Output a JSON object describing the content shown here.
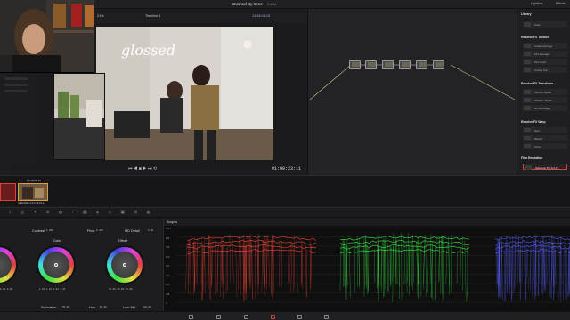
{
  "app": {
    "project_title": "Brushed By Irene",
    "project_state": "Edited"
  },
  "top_right": {
    "lightbox": "Lightbox",
    "fx": "Effects"
  },
  "viewer": {
    "timeline_name": "Timeline 1",
    "source_timecode": "13:48:08:15",
    "clip_label": "Clip",
    "zoom": "21%",
    "playhead_timecode": "01:00:23:11"
  },
  "clip_strip": {
    "clip_timecode": "13:48:08:15",
    "clip_name": "ILIBH Main 4-3-2 12-16-1"
  },
  "library": {
    "tab": "Library",
    "items_top": [
      {
        "label": "Grain"
      }
    ],
    "sections": [
      {
        "title": "Resolve FX Texture",
        "items": [
          "Analog Damage",
          "Film Damage",
          "Film Grain",
          "Texture Pop"
        ]
      },
      {
        "title": "Resolve FX Transform",
        "items": [
          "Camera Shake",
          "Surface Tracker",
          "Mirror Collage"
        ]
      },
      {
        "title": "Resolve FX Warp",
        "items": [
          "Dent",
          "Ripples",
          "Vortex"
        ]
      },
      {
        "title": "Film Emulation",
        "items": [
          "Dehancer Pro 6.2.0"
        ],
        "selected_index": 0
      }
    ]
  },
  "wheels": {
    "contrast_label": "Contrast",
    "contrast_val": "1.000",
    "pivot_label": "Pivot",
    "pivot_val": "0.435",
    "md_label": "MD Detail",
    "md_val": "0.00",
    "gain_label": "Gain",
    "gain_vals": "1.01  1.01  1.01  1.01",
    "offset_label": "Offset",
    "offset_vals": "25.00  25.00  25.00",
    "left_vals": "0.00  0.00",
    "sat_label": "Saturation",
    "sat_val": "50.00",
    "hue_label": "Hue",
    "hue_val": "50.00",
    "lum_label": "Lum Mix",
    "lum_val": "100.00"
  },
  "scopes": {
    "title": "Scopes",
    "axis_ticks": [
      "1023",
      "896",
      "768",
      "640",
      "512",
      "384",
      "256",
      "128",
      "0"
    ]
  },
  "colors": {
    "accent_red": "#d64538",
    "scope_red": "#ff4a3a",
    "scope_green": "#3cff4a",
    "scope_blue": "#5a62ff"
  }
}
